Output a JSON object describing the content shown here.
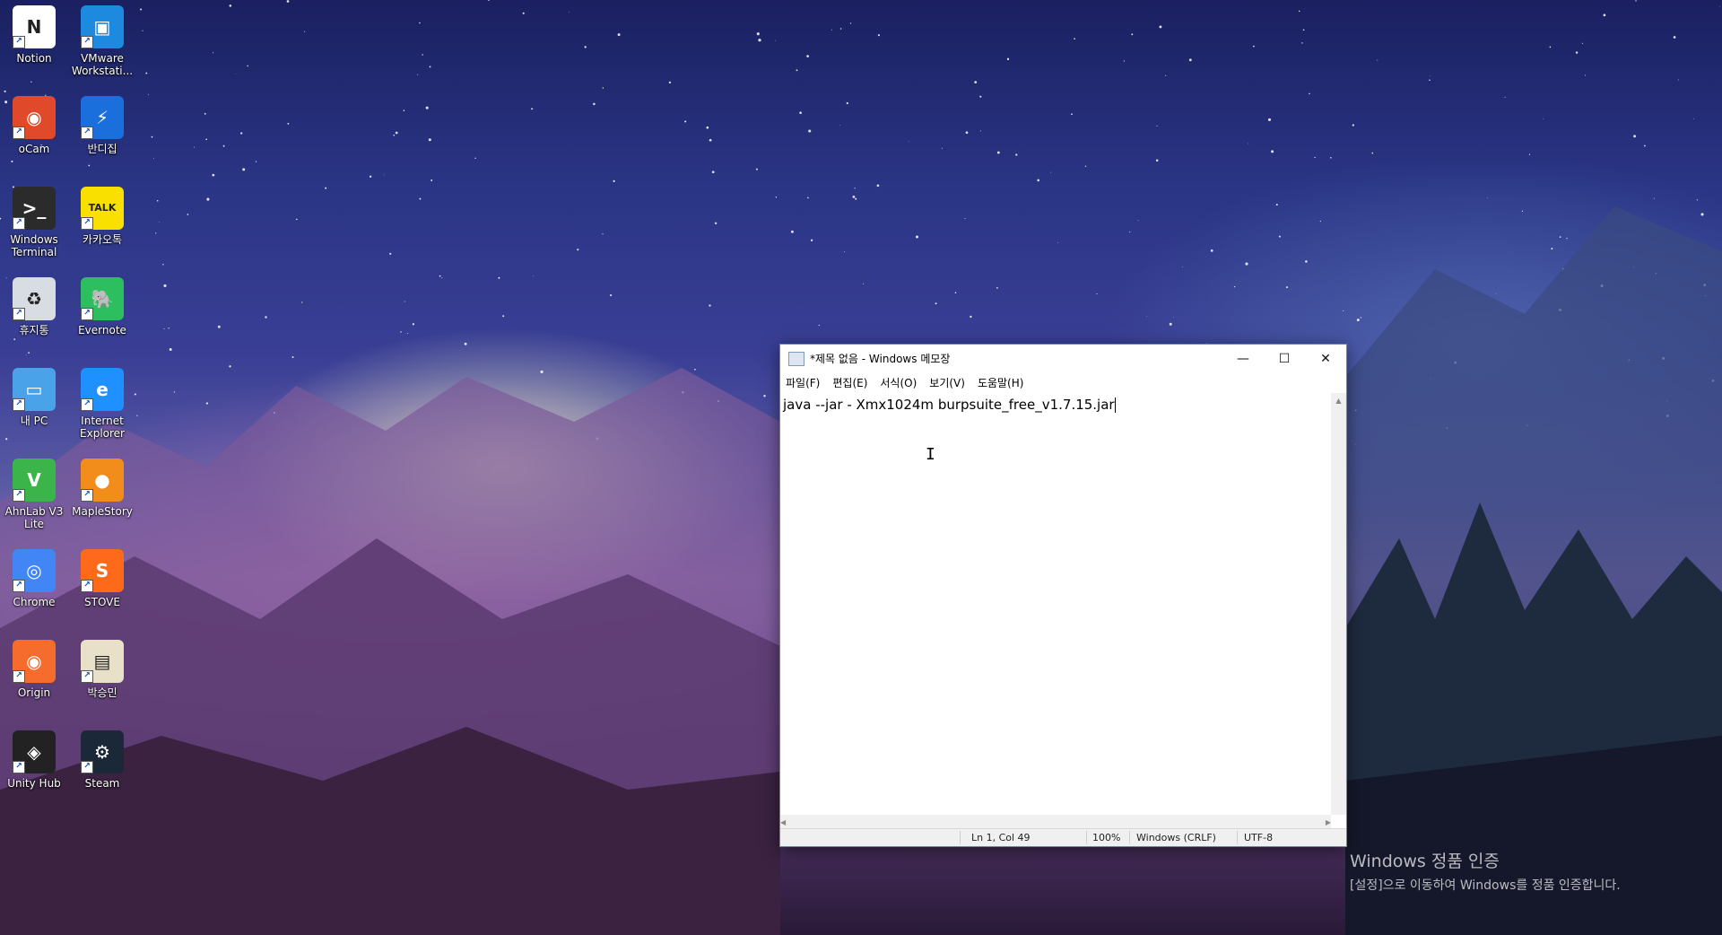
{
  "desktop": {
    "icons": [
      {
        "label": "Notion",
        "icon": "notion-icon",
        "color": "#ffffff"
      },
      {
        "label": "VMware Workstati...",
        "icon": "vmware-icon",
        "color": "#1d8ae0"
      },
      {
        "label": "oCam",
        "icon": "ocam-icon",
        "color": "#e04a2a"
      },
      {
        "label": "반디집",
        "icon": "bandizip-icon",
        "color": "#1a6fdc"
      },
      {
        "label": "Windows Terminal",
        "icon": "terminal-icon",
        "color": "#2b2b2b"
      },
      {
        "label": "카카오톡",
        "icon": "kakaotalk-icon",
        "color": "#f9e000"
      },
      {
        "label": "휴지통",
        "icon": "recycle-bin-icon",
        "color": "#d8dde3"
      },
      {
        "label": "Evernote",
        "icon": "evernote-icon",
        "color": "#2dbe60"
      },
      {
        "label": "내 PC",
        "icon": "this-pc-icon",
        "color": "#4aa3e8"
      },
      {
        "label": "Internet Explorer",
        "icon": "internet-explorer-icon",
        "color": "#1e90ff"
      },
      {
        "label": "AhnLab V3 Lite",
        "icon": "ahnlab-icon",
        "color": "#3bb54a"
      },
      {
        "label": "MapleStory",
        "icon": "maplestory-icon",
        "color": "#f28c1b"
      },
      {
        "label": "Chrome",
        "icon": "chrome-icon",
        "color": "#4285f4"
      },
      {
        "label": "STOVE",
        "icon": "stove-icon",
        "color": "#ff6a1a"
      },
      {
        "label": "Origin",
        "icon": "origin-icon",
        "color": "#f56c2d"
      },
      {
        "label": "박승민",
        "icon": "file-icon",
        "color": "#e8e0c8"
      },
      {
        "label": "Unity Hub",
        "icon": "unity-hub-icon",
        "color": "#222222"
      },
      {
        "label": "Steam",
        "icon": "steam-icon",
        "color": "#1b2838"
      }
    ]
  },
  "notepad": {
    "title": "*제목 없음 - Windows 메모장",
    "menu": [
      "파일(F)",
      "편집(E)",
      "서식(O)",
      "보기(V)",
      "도움말(H)"
    ],
    "content": "java --jar - Xmx1024m burpsuite_free_v1.7.15.jar",
    "buttons": {
      "minimize": "—",
      "maximize": "☐",
      "close": "✕"
    },
    "status": {
      "position": "Ln 1, Col 49",
      "zoom": "100%",
      "line_ending": "Windows (CRLF)",
      "encoding": "UTF-8"
    }
  },
  "watermark": {
    "title": "Windows 정품 인증",
    "subtitle": "[설정]으로 이동하여 Windows를 정품 인증합니다."
  }
}
